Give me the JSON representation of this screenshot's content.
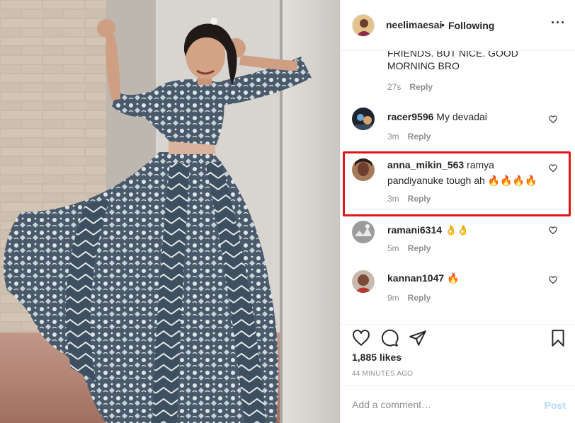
{
  "header": {
    "username": "neelimaesai",
    "dot": "•",
    "follow_status": "Following",
    "more": "···"
  },
  "comments": [
    {
      "user": "",
      "text": "FRIENDS. BUT NICE. GOOD MORNING BRO",
      "line1": "FRIENDS. BUT NICE. GOOD",
      "line2": "MORNING BRO",
      "time": "27s",
      "reply": "Reply"
    },
    {
      "user": "racer9596",
      "text": "My devadai",
      "time": "3m",
      "reply": "Reply"
    },
    {
      "user": "anna_mikin_563",
      "text": "ramya",
      "line2": "pandiyanuke tough ah 🔥🔥🔥🔥",
      "time": "3m",
      "reply": "Reply"
    },
    {
      "user": "ramani6314",
      "text": "👌👌",
      "time": "5m",
      "reply": "Reply"
    },
    {
      "user": "kannan1047",
      "text": "🔥",
      "time": "9m",
      "reply": "Reply"
    }
  ],
  "actions": {
    "icons": [
      "heart-icon",
      "comment-icon",
      "share-icon",
      "bookmark-icon"
    ],
    "likes": "1,885 likes",
    "posted": "44 MINUTES AGO"
  },
  "add_comment": {
    "placeholder": "Add a comment…",
    "post_label": "Post"
  },
  "colors": {
    "highlight": "#e0141b",
    "muted": "#8e8e8e",
    "post_disabled": "#b3dbff"
  }
}
